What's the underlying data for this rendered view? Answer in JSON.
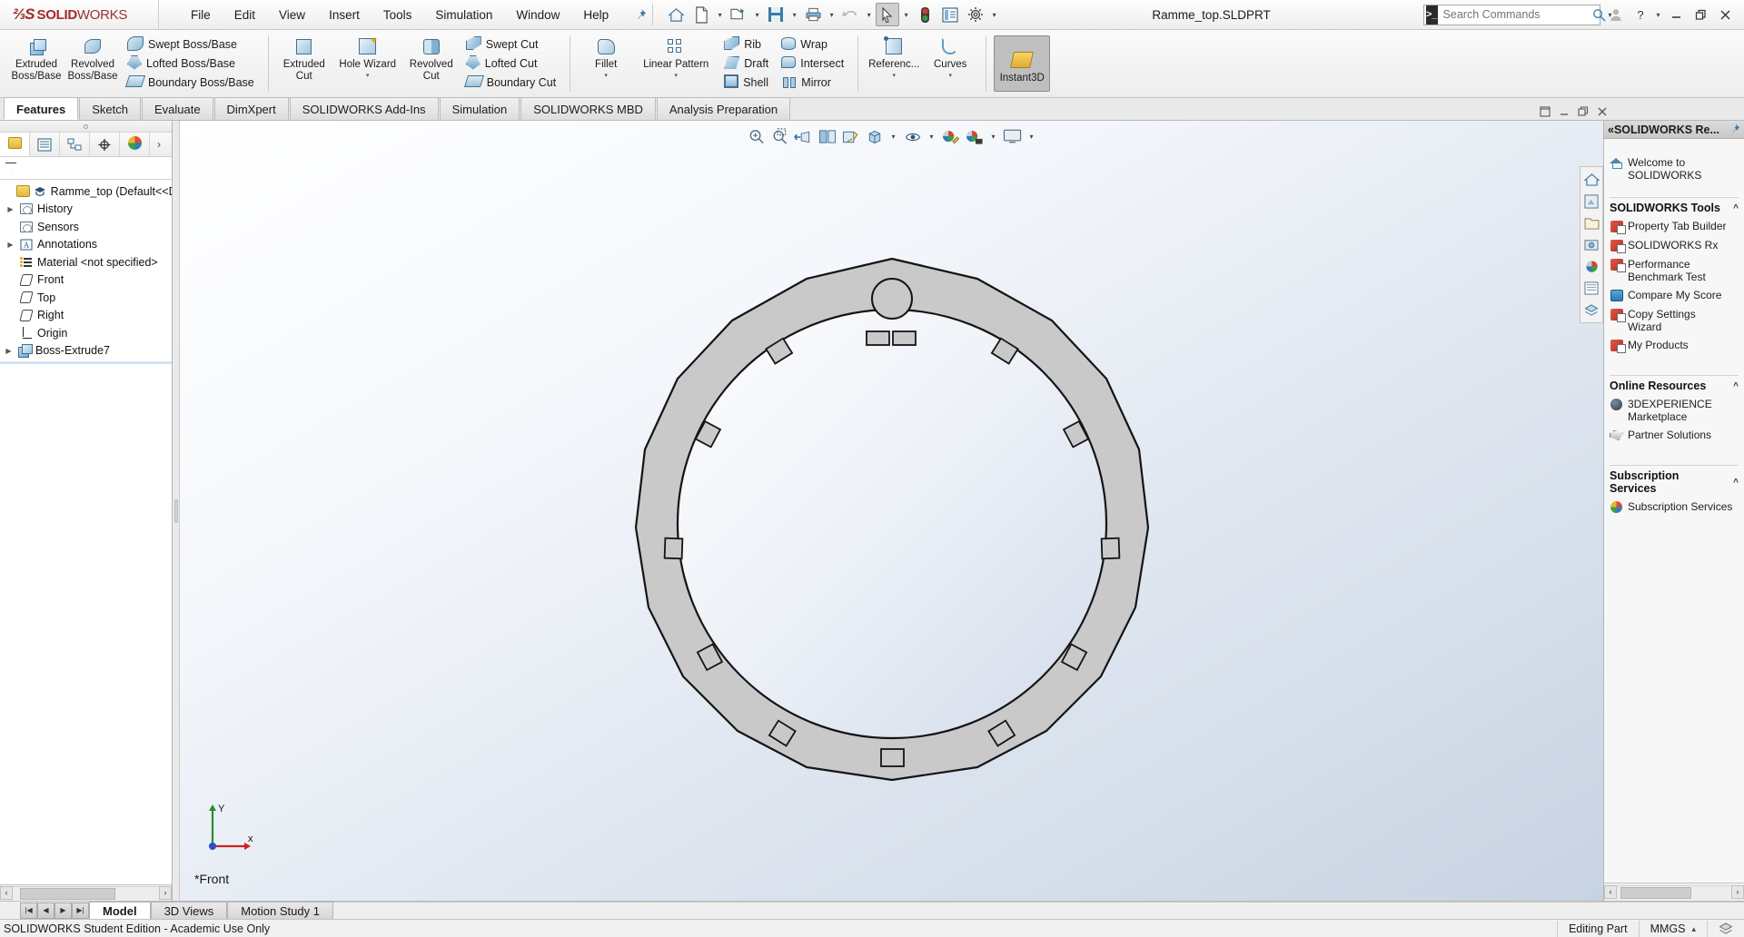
{
  "app": {
    "brand_bold": "SOLID",
    "brand_light": "WORKS",
    "document_title": "Ramme_top.SLDPRT"
  },
  "menubar": {
    "items": [
      "File",
      "Edit",
      "View",
      "Insert",
      "Tools",
      "Simulation",
      "Window",
      "Help"
    ],
    "pin_icon": "pushpin-icon"
  },
  "quick_access": {
    "buttons": [
      {
        "name": "home-icon",
        "label": "Home"
      },
      {
        "name": "new-document-icon",
        "label": "New"
      },
      {
        "name": "open-folder-icon",
        "label": "Open"
      },
      {
        "name": "save-icon",
        "label": "Save"
      },
      {
        "name": "print-icon",
        "label": "Print"
      },
      {
        "name": "undo-icon",
        "label": "Undo"
      },
      {
        "name": "select-cursor-icon",
        "label": "Select"
      },
      {
        "name": "rebuild-traffic-light-icon",
        "label": "Rebuild"
      },
      {
        "name": "file-properties-icon",
        "label": "File Properties"
      },
      {
        "name": "options-gear-icon",
        "label": "Options"
      }
    ]
  },
  "search": {
    "placeholder": "Search Commands",
    "icon": "command-search-icon",
    "magnifier": "magnifier-icon"
  },
  "window_controls": {
    "account": "user-account-icon",
    "help": "?",
    "minimize": "minimize-icon",
    "restore": "restore-icon",
    "close": "close-icon"
  },
  "ribbon": {
    "groups": [
      {
        "big": [
          {
            "label": "Extruded\nBoss/Base",
            "icon": "extruded-boss-base-icon",
            "dropdown": false
          },
          {
            "label": "Revolved\nBoss/Base",
            "icon": "revolved-boss-base-icon",
            "dropdown": false
          }
        ],
        "small": [
          {
            "label": "Swept Boss/Base",
            "icon": "swept-boss-base-icon"
          },
          {
            "label": "Lofted Boss/Base",
            "icon": "lofted-boss-base-icon"
          },
          {
            "label": "Boundary Boss/Base",
            "icon": "boundary-boss-base-icon"
          }
        ]
      },
      {
        "big": [
          {
            "label": "Extruded\nCut",
            "icon": "extruded-cut-icon",
            "dropdown": false
          },
          {
            "label": "Hole Wizard",
            "icon": "hole-wizard-icon",
            "dropdown": true
          },
          {
            "label": "Revolved\nCut",
            "icon": "revolved-cut-icon",
            "dropdown": false
          }
        ],
        "small": [
          {
            "label": "Swept Cut",
            "icon": "swept-cut-icon"
          },
          {
            "label": "Lofted Cut",
            "icon": "lofted-cut-icon"
          },
          {
            "label": "Boundary Cut",
            "icon": "boundary-cut-icon"
          }
        ]
      },
      {
        "big": [
          {
            "label": "Fillet",
            "icon": "fillet-icon",
            "dropdown": true
          },
          {
            "label": "Linear Pattern",
            "icon": "linear-pattern-icon",
            "dropdown": true
          }
        ],
        "small": [
          {
            "label": "Rib",
            "icon": "rib-icon"
          },
          {
            "label": "Draft",
            "icon": "draft-icon"
          },
          {
            "label": "Shell",
            "icon": "shell-icon"
          }
        ],
        "small2": [
          {
            "label": "Wrap",
            "icon": "wrap-icon"
          },
          {
            "label": "Intersect",
            "icon": "intersect-icon"
          },
          {
            "label": "Mirror",
            "icon": "mirror-icon"
          }
        ]
      },
      {
        "big": [
          {
            "label": "Referenc...",
            "icon": "reference-geometry-icon",
            "dropdown": true
          },
          {
            "label": "Curves",
            "icon": "curves-icon",
            "dropdown": true
          }
        ]
      },
      {
        "big": [
          {
            "label": "Instant3D",
            "icon": "instant3d-icon",
            "dropdown": false,
            "active": true
          }
        ]
      }
    ]
  },
  "command_tabs": {
    "items": [
      {
        "label": "Features",
        "active": true
      },
      {
        "label": "Sketch",
        "active": false
      },
      {
        "label": "Evaluate",
        "active": false
      },
      {
        "label": "DimXpert",
        "active": false
      },
      {
        "label": "SOLIDWORKS Add-Ins",
        "active": false
      },
      {
        "label": "Simulation",
        "active": false
      },
      {
        "label": "SOLIDWORKS MBD",
        "active": false
      },
      {
        "label": "Analysis Preparation",
        "active": false
      }
    ],
    "window_buttons": [
      "restore-down-icon",
      "minimize-doc-icon",
      "maximize-doc-icon",
      "close-doc-icon"
    ]
  },
  "feature_manager": {
    "tabs": [
      {
        "name": "feature-manager-design-tree-tab",
        "icon": "yellow-part-icon",
        "active": true
      },
      {
        "name": "property-manager-tab",
        "icon": "property-list-icon",
        "active": false
      },
      {
        "name": "configuration-manager-tab",
        "icon": "configuration-icon",
        "active": false
      },
      {
        "name": "dimxpert-manager-tab",
        "icon": "dimxpert-target-icon",
        "active": false
      },
      {
        "name": "display-manager-tab",
        "icon": "appearance-sphere-icon",
        "active": false
      }
    ],
    "more_caret": "›",
    "filter_icon": "filter-funnel-icon",
    "tree": [
      {
        "label": "Ramme_top  (Default<<De",
        "icon": "part-document-icon",
        "arrow": false,
        "indent": 0,
        "badge": "graduation-cap-icon"
      },
      {
        "label": "History",
        "icon": "history-folder-icon",
        "arrow": true,
        "indent": 1
      },
      {
        "label": "Sensors",
        "icon": "sensors-folder-icon",
        "arrow": false,
        "indent": 1
      },
      {
        "label": "Annotations",
        "icon": "annotations-folder-icon",
        "arrow": true,
        "indent": 1
      },
      {
        "label": "Material <not specified>",
        "icon": "material-icon",
        "arrow": false,
        "indent": 1
      },
      {
        "label": "Front",
        "icon": "plane-icon",
        "arrow": false,
        "indent": 1
      },
      {
        "label": "Top",
        "icon": "plane-icon",
        "arrow": false,
        "indent": 1
      },
      {
        "label": "Right",
        "icon": "plane-icon",
        "arrow": false,
        "indent": 1
      },
      {
        "label": "Origin",
        "icon": "origin-icon",
        "arrow": false,
        "indent": 1
      },
      {
        "label": "Boss-Extrude7",
        "icon": "boss-extrude-icon",
        "arrow": true,
        "indent": 0
      }
    ]
  },
  "viewport": {
    "heads_up": [
      {
        "name": "zoom-to-fit-icon",
        "caret": false
      },
      {
        "name": "zoom-to-area-icon",
        "caret": false
      },
      {
        "name": "previous-view-icon",
        "caret": false
      },
      {
        "name": "section-view-icon",
        "caret": false
      },
      {
        "name": "view-orientation-icon",
        "caret": false
      },
      {
        "name": "display-style-icon",
        "caret": true
      },
      {
        "name": "hide-show-items-icon",
        "caret": true
      },
      {
        "name": "edit-appearance-icon",
        "caret": false
      },
      {
        "name": "apply-scene-icon",
        "caret": true
      },
      {
        "name": "view-settings-icon",
        "caret": true
      }
    ],
    "right_strip": [
      "view-home-icon",
      "model-view-icon",
      "folder-view-icon",
      "photoview-icon",
      "appearance-icon",
      "display-pane-icon",
      "layers-icon"
    ],
    "view_label": "*Front",
    "triad": {
      "x_label": "x",
      "y_label": "Y",
      "x_color": "#cc2222",
      "y_color": "#2a8c2a",
      "z_color": "#2a4fcc"
    },
    "model": {
      "name": "ring-frame-part",
      "fill_color": "#c9c9c9",
      "edge_color": "#1a1a1a"
    }
  },
  "task_pane": {
    "header_title": "«SOLIDWORKS Re...",
    "pin_icon": "pushpin-icon",
    "welcome": {
      "label": "Welcome to SOLIDWORKS",
      "icon": "welcome-home-icon"
    },
    "sections": [
      {
        "title": "SOLIDWORKS Tools",
        "chevron": "^",
        "items": [
          {
            "label": "Property Tab Builder",
            "icon": "property-tab-builder-icon"
          },
          {
            "label": "SOLIDWORKS Rx",
            "icon": "solidworks-rx-icon"
          },
          {
            "label": "Performance Benchmark Test",
            "icon": "performance-benchmark-icon"
          },
          {
            "label": "Compare My Score",
            "icon": "compare-my-score-icon"
          },
          {
            "label": "Copy Settings Wizard",
            "icon": "copy-settings-wizard-icon"
          },
          {
            "label": "My Products",
            "icon": "my-products-icon"
          }
        ]
      },
      {
        "title": "Online Resources",
        "chevron": "^",
        "items": [
          {
            "label": "3DEXPERIENCE Marketplace",
            "icon": "3dexperience-marketplace-icon"
          },
          {
            "label": "Partner Solutions",
            "icon": "partner-solutions-icon"
          }
        ]
      },
      {
        "title": "Subscription Services",
        "chevron": "^",
        "items": [
          {
            "label": "Subscription Services",
            "icon": "subscription-services-icon"
          }
        ]
      }
    ],
    "side_strip": [
      "solidworks-resources-icon",
      "design-library-icon",
      "file-explorer-icon",
      "view-palette-icon",
      "appearances-scenes-icon",
      "custom-properties-icon",
      "solidworks-forum-icon"
    ]
  },
  "bottom_tabs": {
    "nav": [
      "|◀",
      "◀",
      "▶",
      "▶|"
    ],
    "items": [
      {
        "label": "Model",
        "active": true
      },
      {
        "label": "3D Views",
        "active": false
      },
      {
        "label": "Motion Study 1",
        "active": false
      }
    ]
  },
  "status_bar": {
    "left": "SOLIDWORKS Student Edition - Academic Use Only",
    "editing": "Editing Part",
    "units": "MMGS",
    "units_caret": "▴",
    "overlay_icon": "display-overlay-icon"
  }
}
